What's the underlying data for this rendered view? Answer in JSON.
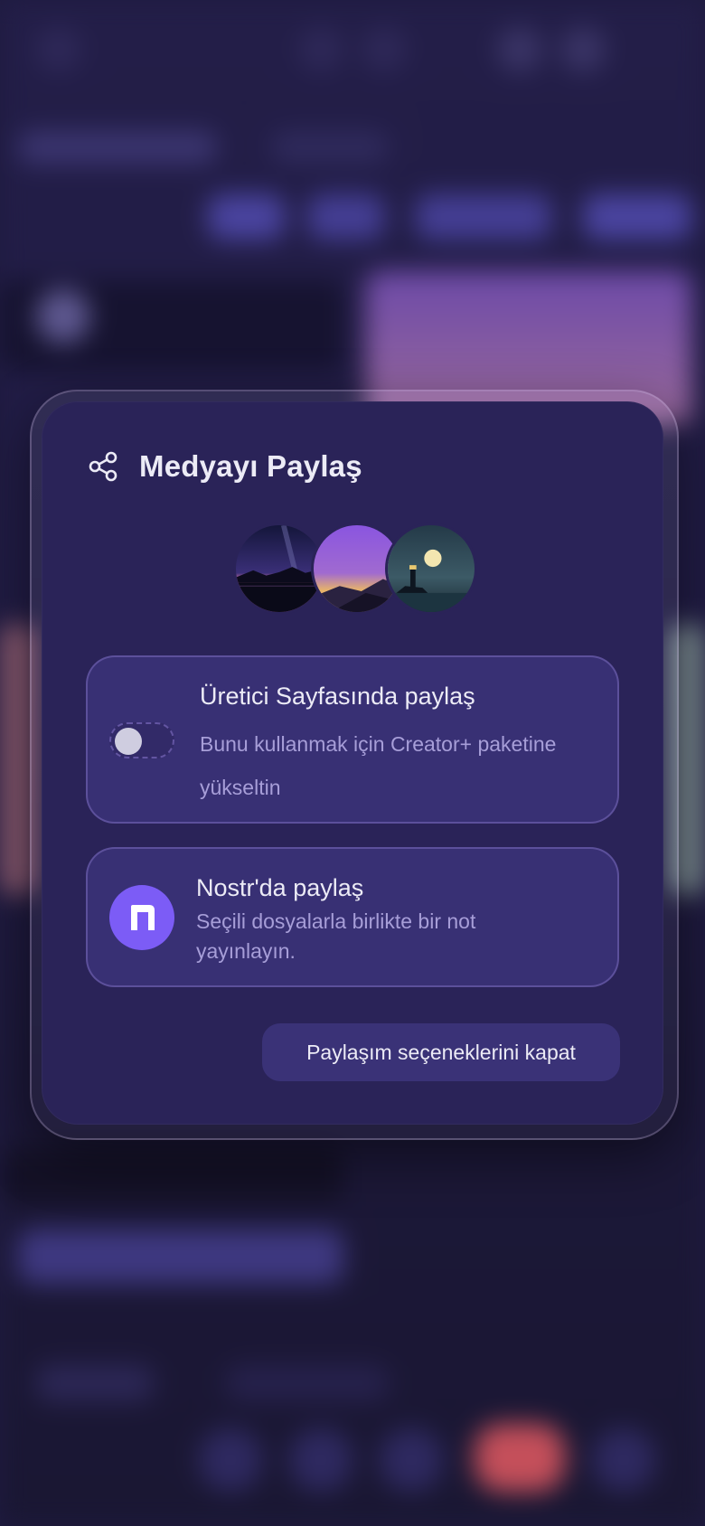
{
  "modal": {
    "title": "Medyayı Paylaş",
    "icon": "share-icon",
    "thumbnails": [
      {
        "name": "night-lake-mountains-thumbnail"
      },
      {
        "name": "purple-sunset-hills-thumbnail"
      },
      {
        "name": "lighthouse-moon-thumbnail"
      }
    ],
    "creator_option": {
      "title": "Üretici Sayfasında paylaş",
      "description": "Bunu kullanmak için Creator+ paketine yükseltin",
      "enabled": false
    },
    "nostr_option": {
      "title": "Nostr'da paylaş",
      "description": "Seçili dosyalarla birlikte bir not yayınlayın.",
      "icon": "nostr-logo-icon"
    },
    "close_button": "Paylaşım seçeneklerini kapat"
  },
  "colors": {
    "modal_background": "#2a2358",
    "card_background": "#383074",
    "accent": "#7c5cf6",
    "text_primary": "#ecebf6",
    "text_secondary": "#a79ed8"
  }
}
